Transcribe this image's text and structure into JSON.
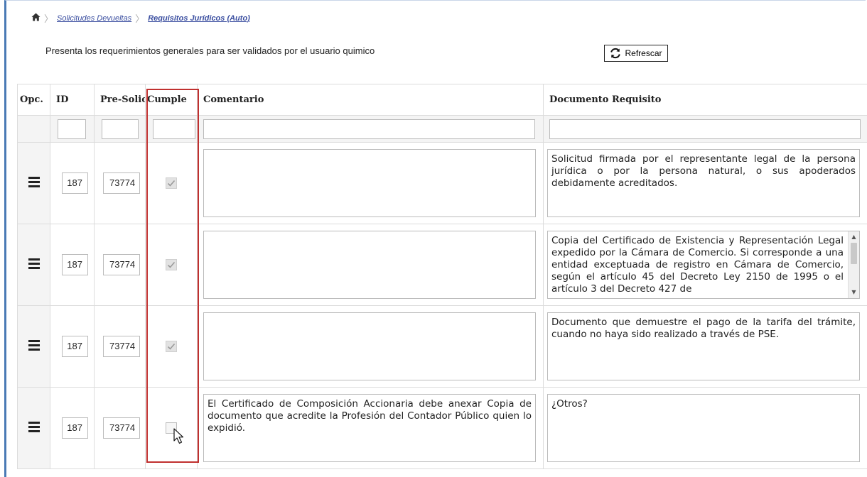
{
  "breadcrumb": {
    "home_icon": "home-icon",
    "items": [
      "Solicitudes Devueltas",
      "Requisitos Jurídicos (Auto)"
    ]
  },
  "description": "Presenta los requerimientos generales para ser validados por el usuario quimico",
  "toolbar": {
    "refresh_label": "Refrescar",
    "refresh_icon": "refresh-icon"
  },
  "table": {
    "columns": [
      "Opc.",
      "ID",
      "Pre-Solic",
      "Cumple",
      "Comentario",
      "Documento Requisito"
    ],
    "rows": [
      {
        "id": "187",
        "pre_solicitud": "73774",
        "cumple": true,
        "comentario": "",
        "documento": "Solicitud firmada por el representante legal de la persona jurídica o por la persona natural, o sus apoderados debidamente acreditados."
      },
      {
        "id": "187",
        "pre_solicitud": "73774",
        "cumple": true,
        "comentario": "",
        "documento": "Copia del Certificado de Existencia y Representación Legal expedido por la Cámara de Comercio. Si corresponde a una entidad exceptuada de registro en Cámara de Comercio, según el artículo 45 del Decreto Ley 2150 de 1995 o el artículo 3 del Decreto 427 de"
      },
      {
        "id": "187",
        "pre_solicitud": "73774",
        "cumple": true,
        "comentario": "",
        "documento": "Documento que demuestre el pago de la tarifa del trámite, cuando no haya sido realizado a través de PSE."
      },
      {
        "id": "187",
        "pre_solicitud": "73774",
        "cumple": false,
        "comentario": "El Certificado de Composición Accionaria debe anexar Copia de documento que acredite la Profesión del Contador Público quien lo expidió.",
        "documento": "¿Otros?"
      }
    ]
  },
  "colors": {
    "highlight": "#c0302f",
    "frame_accent": "#4a7ab5",
    "link": "#3a4ea0"
  }
}
